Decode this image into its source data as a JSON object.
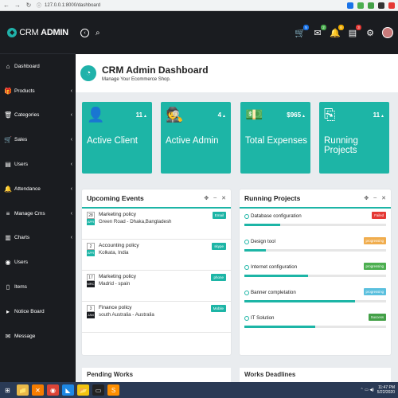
{
  "browser": {
    "url": "127.0.0.1:8000/dashboard",
    "extension_colors": [
      "#1a73e8",
      "#4caf50",
      "#43a047",
      "#333333",
      "#e53935"
    ]
  },
  "brand": {
    "name_prefix": "CRM",
    "name_suffix": "ADMIN",
    "accent": "#20b2aa"
  },
  "sidebar": {
    "items": [
      {
        "label": "Dashboard",
        "icon": "home-icon",
        "glyph": "⌂",
        "chevron": false
      },
      {
        "label": "Products",
        "icon": "gift-icon",
        "glyph": "🎁",
        "chevron": true
      },
      {
        "label": "Categories",
        "icon": "trash-icon",
        "glyph": "🗑",
        "chevron": true
      },
      {
        "label": "Sales",
        "icon": "cart-icon",
        "glyph": "🛒",
        "chevron": true
      },
      {
        "label": "Users",
        "icon": "inbox-icon",
        "glyph": "▤",
        "chevron": true
      },
      {
        "label": "Attendance",
        "icon": "bell-icon",
        "glyph": "🔔",
        "chevron": true
      },
      {
        "label": "Manage Cms",
        "icon": "sliders-icon",
        "glyph": "≡",
        "chevron": true
      },
      {
        "label": "Charts",
        "icon": "bar-chart-icon",
        "glyph": "▥",
        "chevron": true
      },
      {
        "label": "Users",
        "icon": "user-icon",
        "glyph": "◉",
        "chevron": false
      },
      {
        "label": "Items",
        "icon": "document-icon",
        "glyph": "▯",
        "chevron": false
      },
      {
        "label": "Notice Board",
        "icon": "bullhorn-icon",
        "glyph": "▸",
        "chevron": false
      },
      {
        "label": "Message",
        "icon": "envelope-icon",
        "glyph": "✉",
        "chevron": false
      }
    ]
  },
  "topbar": {
    "notifications": [
      {
        "icon": "cart-icon",
        "glyph": "🛒",
        "badge": "5",
        "color": "#1a73e8"
      },
      {
        "icon": "chat-icon",
        "glyph": "✉",
        "badge": "2",
        "color": "#4caf50"
      },
      {
        "icon": "bell-icon",
        "glyph": "🔔",
        "badge": "6",
        "color": "#f0ad00"
      },
      {
        "icon": "clipboard-icon",
        "glyph": "▤",
        "badge": "3",
        "color": "#e53935"
      },
      {
        "icon": "gear-icon",
        "glyph": "⚙",
        "badge": "",
        "color": "#555"
      }
    ]
  },
  "header": {
    "title": "CRM Admin Dashboard",
    "subtitle": "Manage Your Ecommerce Shop."
  },
  "cards": [
    {
      "title": "Active Client",
      "value": "11",
      "icon": "user-plus-icon",
      "glyph": "👤"
    },
    {
      "title": "Active Admin",
      "value": "4",
      "icon": "spy-icon",
      "glyph": "🕵"
    },
    {
      "title": "Total Expenses",
      "value": "$965",
      "icon": "money-icon",
      "glyph": "💵"
    },
    {
      "title": "Running Projects",
      "value": "11",
      "icon": "files-icon",
      "glyph": "⎘"
    }
  ],
  "events": {
    "title": "Upcoming Events",
    "items": [
      {
        "day": "28",
        "month": "APR",
        "title": "Marketing policy",
        "location": "Green Road - Dhaka,Bangladesh",
        "tag": "Email",
        "dark": false
      },
      {
        "day": "2",
        "month": "APR",
        "title": "Accounting policy",
        "location": "Kolkata, India",
        "tag": "skype",
        "dark": false
      },
      {
        "day": "17",
        "month": "MRC",
        "title": "Marketing policy",
        "location": "Madrid - spain",
        "tag": "phone",
        "dark": true
      },
      {
        "day": "3",
        "month": "JAN",
        "title": "Finance policy",
        "location": "south Australia - Australia",
        "tag": "Mobile",
        "dark": true
      }
    ]
  },
  "projects": {
    "title": "Running Projects",
    "items": [
      {
        "name": "Database configuration",
        "status": "Failed",
        "status_color": "#e53935",
        "progress": 0.25
      },
      {
        "name": "Design tool",
        "status": "progressing",
        "status_color": "#f0ad4e",
        "progress": 0.15
      },
      {
        "name": "Internet configuration",
        "status": "progressing",
        "status_color": "#4caf50",
        "progress": 0.45
      },
      {
        "name": "Banner completation",
        "status": "progressing",
        "status_color": "#5bc0de",
        "progress": 0.78
      },
      {
        "name": "IT Solution",
        "status": "Success",
        "status_color": "#43a047",
        "progress": 0.5
      }
    ]
  },
  "bottom_panels": [
    "Pending Works",
    "Works Deadlines"
  ],
  "taskbar": {
    "apps": [
      {
        "icon": "start-icon",
        "glyph": "⊞",
        "color": "#2a3a55"
      },
      {
        "icon": "explorer-icon",
        "glyph": "📁",
        "color": "#e9b949"
      },
      {
        "icon": "xampp-icon",
        "glyph": "✕",
        "color": "#f57c00"
      },
      {
        "icon": "chrome-icon",
        "glyph": "◉",
        "color": "#db4437"
      },
      {
        "icon": "vscode-icon",
        "glyph": "◣",
        "color": "#1e88e5"
      },
      {
        "icon": "folder-icon",
        "glyph": "📂",
        "color": "#f1c40f"
      },
      {
        "icon": "terminal-icon",
        "glyph": "▭",
        "color": "#222"
      },
      {
        "icon": "sublime-icon",
        "glyph": "S",
        "color": "#ff8f00"
      }
    ],
    "time": "11:47 PM",
    "date": "5/22/2020"
  }
}
